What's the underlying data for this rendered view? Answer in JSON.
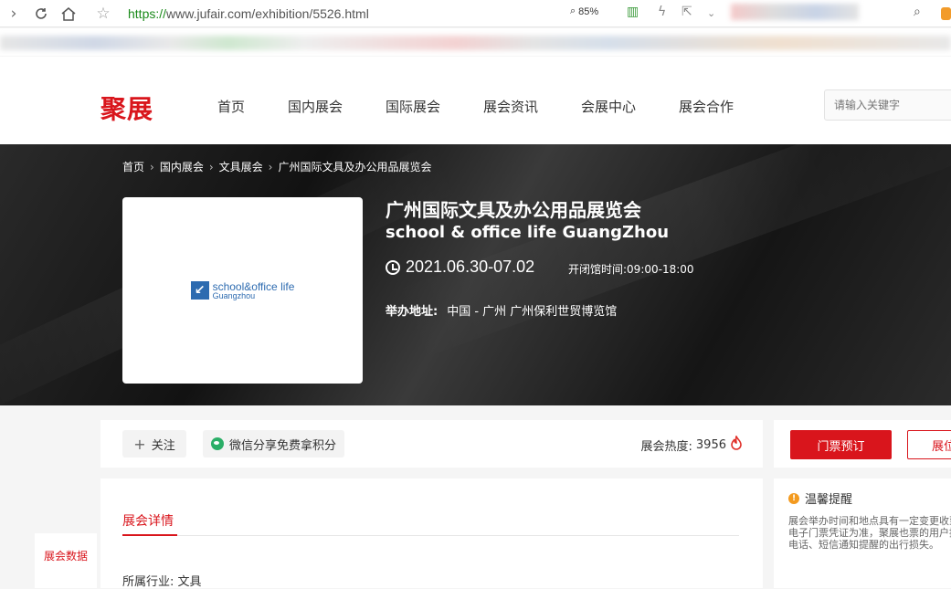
{
  "browser": {
    "url_protocol": "https://",
    "url_rest": "www.jufair.com/exhibition/5526.html",
    "zoom": "85%"
  },
  "site": {
    "logo": "聚展",
    "nav": [
      "首页",
      "国内展会",
      "国际展会",
      "展会资讯",
      "会展中心",
      "展会合作"
    ],
    "search_placeholder": "请输入关键字"
  },
  "breadcrumb": [
    "首页",
    "国内展会",
    "文具展会",
    "广州国际文具及办公用品展览会"
  ],
  "exhibition": {
    "poster_line1": "school&office life",
    "poster_line2": "Guangzhou",
    "title": "广州国际文具及办公用品展览会",
    "subtitle": "school & office life GuangZhou",
    "date": "2021.06.30-07.02",
    "hours": "开闭馆时间:09:00-18:00",
    "address_label": "举办地址:",
    "address": "中国 - 广州 广州保利世贸博览馆"
  },
  "actions": {
    "follow": "关注",
    "share": "微信分享免费拿积分",
    "heat_label": "展会热度:",
    "heat_value": "3956"
  },
  "detail": {
    "tab": "展会详情",
    "industry": "所属行业: 文具"
  },
  "side_nav": {
    "item": "展会数据"
  },
  "sidebar": {
    "ticket": "门票预订",
    "exhibit": "展位",
    "notice_title": "温馨提醒",
    "notice_text": "展会举办时间和地点具有一定变更收到的电子门票凭证为准，聚展也票的用户提供电话、短信通知提醒的出行损失。"
  },
  "colors": {
    "brand": "#d9151c",
    "url_green": "#1a8a1a"
  }
}
